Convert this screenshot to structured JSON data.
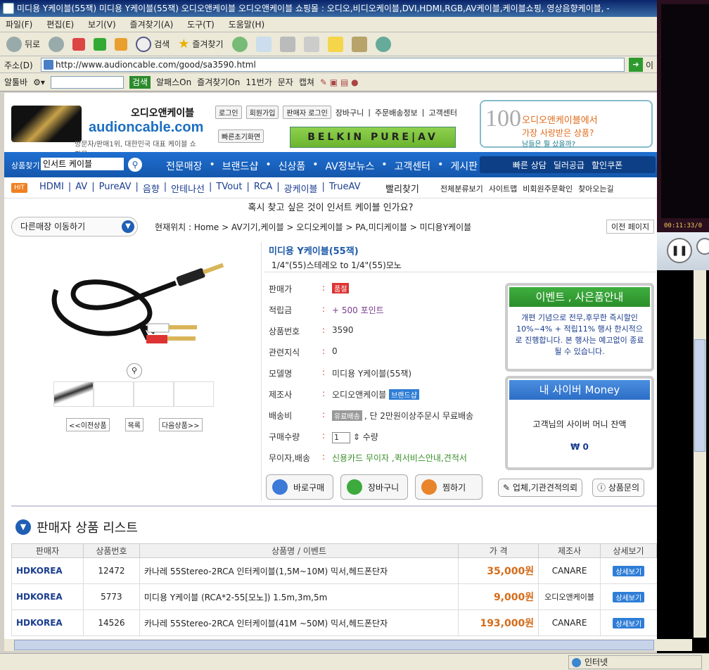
{
  "window": {
    "title": "미디용 Y케이블(55잭) 미디용 Y케이블(55잭) 오디오앤케이블 오디오앤케이블 쇼핑몰 : 오디오,비디오케이블,DVI,HDMI,RGB,AV케이블,케이블쇼핑, 영상음향케이블, -"
  },
  "menu": [
    "파일(F)",
    "편집(E)",
    "보기(V)",
    "즐겨찾기(A)",
    "도구(T)",
    "도움말(H)"
  ],
  "toolbar": {
    "back": "뒤로",
    "search": "검색",
    "favorites": "즐겨찾기"
  },
  "address": {
    "label": "주소(D)",
    "url": "http://www.audioncable.com/good/sa3590.html",
    "go": "이"
  },
  "links": {
    "altoolbar": "알툴바",
    "search_btn": "검색",
    "alpass": "알패스On",
    "fav_on": "즐겨찾기On",
    "eleven": "11번가",
    "sms": "문자",
    "capture": "캡쳐"
  },
  "header": {
    "brand_kr": "오디오앤케이블",
    "brand_en": "audioncable.com",
    "brand_sub": "방문자/판매1위, 대한민국 대표 케이블 쇼핑몰",
    "login": "로그인",
    "join": "회원가입",
    "seller_login": "판매자 로그인",
    "top_links": [
      "장바구니",
      "주문배송정보",
      "고객센터"
    ],
    "reset_view": "빠른초기화면",
    "belkin": "BELKIN  PURE|AV",
    "promo_num": "100",
    "promo_line1": "오디오앤케이블에서",
    "promo_line2": "가장 사랑받은 상품?",
    "promo_line3": "남들은 뭘 샀을까?"
  },
  "nav": {
    "search_label": "상품찾기",
    "search_value": "인서트 케이블",
    "menu": [
      "전문매장",
      "브랜드샵",
      "신상품",
      "AV정보뉴스",
      "고객센터",
      "게시판"
    ],
    "right": [
      "빠른 상담",
      "딜러공급",
      "할인쿠폰"
    ]
  },
  "subnav": {
    "hit": "HIT",
    "items": [
      "HDMI",
      "AV",
      "PureAV",
      "음향",
      "안테나선",
      "TVout",
      "RCA",
      "광케이블",
      "TrueAV"
    ],
    "extra": "빨리찾기",
    "right": [
      "전체분류보기",
      "사이트맵",
      "비회원주문확인",
      "찾아오는길"
    ]
  },
  "search_question": "혹시 찾고 싶은 것이 인서트 케이블 인가요?",
  "breadcrumb": {
    "store_move": "다른매장 이동하기",
    "path": "현재위치 : Home > AV기기,케이블 > 오디오케이블 > PA,미디케이블 > 미디용Y케이블",
    "prev_page": "이전 페이지"
  },
  "product": {
    "name": "미디용 Y케이블(55잭)",
    "desc": "1/4\"(55)스테레오 to 1/4\"(55)모노",
    "prev": "<<이전상품",
    "list": "목록",
    "next": "다음상품>>",
    "fields": [
      {
        "k": "판매가",
        "tag": "품절",
        "v": ""
      },
      {
        "k": "적립금",
        "v": "+ 500 포인트"
      },
      {
        "k": "상품번호",
        "v": "3590"
      },
      {
        "k": "관련지식",
        "v": "0"
      },
      {
        "k": "모델명",
        "v": "미디용 Y케이블(55잭)"
      },
      {
        "k": "제조사",
        "v": "오디오앤케이블",
        "tag": "브랜드샵"
      },
      {
        "k": "배송비",
        "tag": "유료배송",
        "v": ", 단 2만원이상주문시 무료배송"
      },
      {
        "k": "구매수량",
        "qty": "1",
        "v": "수량"
      },
      {
        "k": "무이자,배송",
        "v": "신용카드 무이자 ,퀵서비스안내,견적서"
      }
    ],
    "buy": "바로구매",
    "cart": "장바구니",
    "wish": "찜하기",
    "quote": "업체,기관견적의뢰",
    "inquiry": "상품문의"
  },
  "event": {
    "title": "이벤트 , 사은품안내",
    "body": "개편 기념으로 전무,후무한 즉시할인 10%~4% + 적립11% 행사 한시적으로 진행합니다. 본 행사는 예고없이 종료될 수 있습니다."
  },
  "money": {
    "title": "내 사이버 Money",
    "text": "고객님의 사이버 머니 잔액",
    "value": "0"
  },
  "seller_list": {
    "title": "판매자 상품 리스트",
    "headers": [
      "판매자",
      "상품번호",
      "상품명 / 이벤트",
      "가 격",
      "제조사",
      "상세보기"
    ],
    "rows": [
      {
        "seller": "HDKOREA",
        "no": "12472",
        "name": "카나레 55Stereo-2RCA 인터케이블(1,5M~10M) 믹서,헤드폰단자",
        "price": "35,000원",
        "maker": "CANARE",
        "detail": "상세보기"
      },
      {
        "seller": "HDKOREA",
        "no": "5773",
        "name": "미디용 Y케이블 (RCA*2-55[모노]) 1.5m,3m,5m",
        "price": "9,000원",
        "maker": "오디오앤케이블",
        "detail": "상세보기"
      },
      {
        "seller": "HDKOREA",
        "no": "14526",
        "name": "카나레 55Stereo-2RCA 인터케이블(41M ~50M) 믹서,헤드폰단자",
        "price": "193,000원",
        "maker": "CANARE",
        "detail": "상세보기"
      }
    ]
  },
  "status": {
    "zone": "인터넷"
  },
  "player": {
    "time": "00:11:33/0"
  }
}
